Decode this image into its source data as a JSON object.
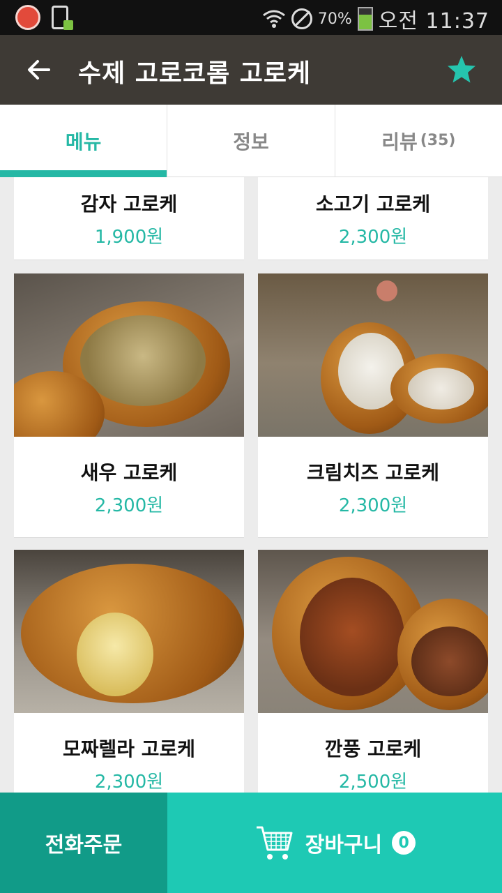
{
  "status_bar": {
    "battery_percent": "70%",
    "battery_level": 0.7,
    "time": "오전 11:37"
  },
  "toolbar": {
    "title": "수제 고로코롬 고로케",
    "back_icon": "arrow-back-icon",
    "favorite_icon": "star-icon"
  },
  "tabs": [
    {
      "label": "메뉴",
      "count": "",
      "active": true
    },
    {
      "label": "정보",
      "count": "",
      "active": false
    },
    {
      "label": "리뷰",
      "count": "(35)",
      "active": false
    }
  ],
  "menu_items": [
    {
      "name": "감자 고로케",
      "price": "1,900원"
    },
    {
      "name": "소고기 고로케",
      "price": "2,300원"
    },
    {
      "name": "새우 고로케",
      "price": "2,300원"
    },
    {
      "name": "크림치즈 고로케",
      "price": "2,300원"
    },
    {
      "name": "모짜렐라 고로케",
      "price": "2,300원"
    },
    {
      "name": "깐풍 고로케",
      "price": "2,500원"
    }
  ],
  "bottom_bar": {
    "phone_order_label": "전화주문",
    "cart_label": "장바구니",
    "cart_count": "0",
    "cart_icon": "shopping-cart-icon"
  },
  "colors": {
    "accent": "#25b8a5",
    "toolbar": "#3e3a35",
    "phone_order_bg": "#119b88",
    "cart_bg": "#1ec9b4"
  }
}
